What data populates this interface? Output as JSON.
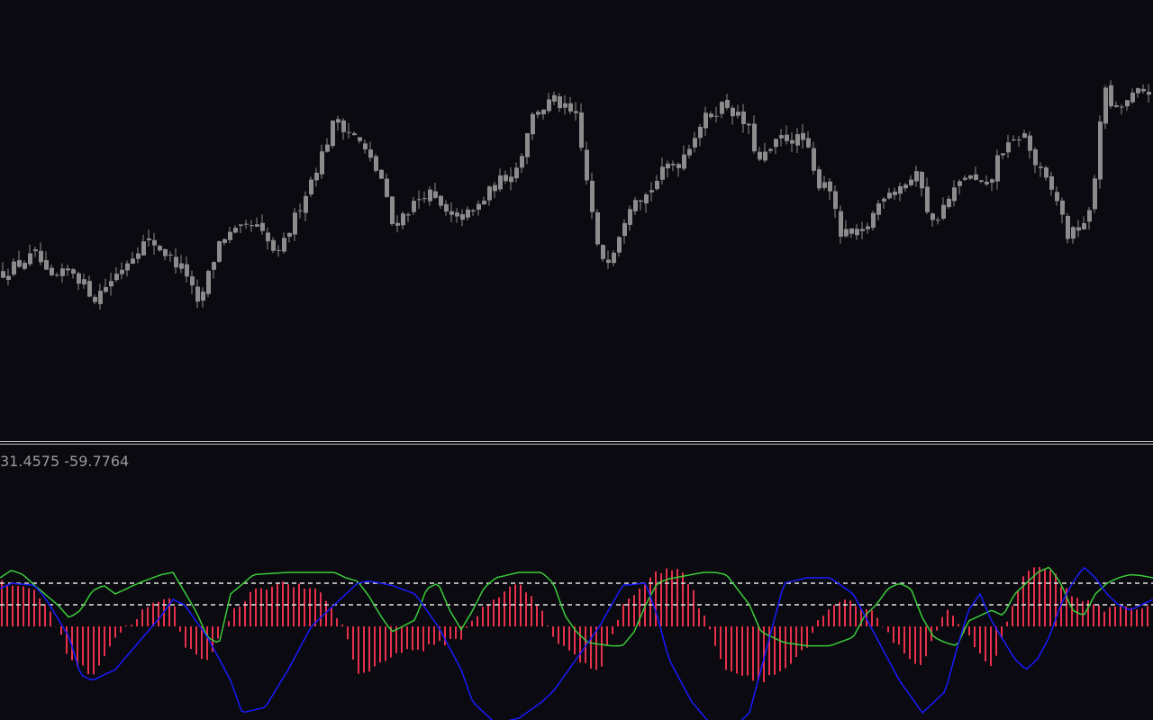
{
  "indicator": {
    "label": "31.4575 -59.7764"
  },
  "colors": {
    "background": "#0a0a10",
    "candle": "#8c8c8c",
    "separator": "#c0c0c0",
    "histogram": "#e8304a",
    "line_fast": "#3ccc3c",
    "line_slow": "#1a1aff",
    "level_lines": "#e6e6e6",
    "label_text": "#9a9a9a"
  },
  "chart_data": [
    {
      "type": "candlestick",
      "title": "",
      "xlabel": "",
      "ylabel": "",
      "ylim": [
        0,
        100
      ],
      "grid": false,
      "close_path": [
        [
          0,
          22
        ],
        [
          3,
          28
        ],
        [
          4,
          19
        ],
        [
          6,
          23
        ],
        [
          8,
          14
        ],
        [
          10,
          22
        ],
        [
          12,
          31
        ],
        [
          13,
          32
        ],
        [
          16,
          22
        ],
        [
          17,
          11
        ],
        [
          19,
          33
        ],
        [
          22,
          37
        ],
        [
          24,
          27
        ],
        [
          26,
          44
        ],
        [
          28,
          61
        ],
        [
          29,
          71
        ],
        [
          31,
          64
        ],
        [
          33,
          52
        ],
        [
          34,
          37
        ],
        [
          37,
          48
        ],
        [
          39,
          39
        ],
        [
          41,
          41
        ],
        [
          43,
          50
        ],
        [
          45,
          56
        ],
        [
          46,
          71
        ],
        [
          48,
          77
        ],
        [
          50,
          71
        ],
        [
          51,
          50
        ],
        [
          52,
          27
        ],
        [
          53,
          27
        ],
        [
          55,
          47
        ],
        [
          56,
          46
        ],
        [
          58,
          56
        ],
        [
          59,
          57
        ],
        [
          61,
          70
        ],
        [
          63,
          76
        ],
        [
          65,
          68
        ],
        [
          66,
          57
        ],
        [
          68,
          65
        ],
        [
          70,
          64
        ],
        [
          71,
          50
        ],
        [
          72,
          52
        ],
        [
          73,
          34
        ],
        [
          75,
          34
        ],
        [
          77,
          48
        ],
        [
          78,
          49
        ],
        [
          80,
          53
        ],
        [
          81,
          37
        ],
        [
          84,
          53
        ],
        [
          86,
          48
        ],
        [
          87,
          61
        ],
        [
          88,
          62
        ],
        [
          89,
          67
        ],
        [
          90,
          57
        ],
        [
          92,
          45
        ],
        [
          93,
          33
        ],
        [
          95,
          41
        ],
        [
          96,
          81
        ],
        [
          97,
          73
        ],
        [
          99,
          79
        ],
        [
          100,
          80
        ]
      ]
    },
    {
      "type": "line",
      "title": "",
      "xlabel": "",
      "ylabel": "",
      "ylim": [
        -100,
        100
      ],
      "levels": [
        40,
        20
      ],
      "grid": false,
      "series": [
        {
          "role": "histogram",
          "x": [
            0,
            3,
            5,
            6,
            8,
            10,
            13,
            15,
            16,
            18,
            20,
            22,
            25,
            28,
            30,
            31,
            33,
            34,
            37,
            40,
            42,
            45,
            47,
            48,
            50,
            52,
            54,
            57,
            59,
            60,
            63,
            66,
            68,
            70,
            71,
            73,
            76,
            78,
            80,
            82,
            84,
            86,
            88,
            89,
            91,
            93,
            95,
            96,
            98,
            100
          ],
          "values": [
            40,
            35,
            0,
            -30,
            -45,
            -10,
            20,
            25,
            -20,
            -30,
            10,
            35,
            40,
            30,
            -5,
            -45,
            -35,
            -25,
            -20,
            -10,
            20,
            40,
            15,
            -10,
            -30,
            -40,
            20,
            50,
            55,
            35,
            -40,
            -50,
            -40,
            -20,
            5,
            25,
            10,
            -20,
            -40,
            20,
            -10,
            -40,
            25,
            50,
            55,
            25,
            20,
            15,
            20,
            15
          ]
        },
        {
          "role": "fast",
          "x": [
            0,
            1,
            2,
            3,
            5,
            6,
            7,
            8,
            9,
            10,
            12,
            14,
            15,
            17,
            18,
            19,
            20,
            22,
            25,
            27,
            29,
            30,
            31,
            32,
            33,
            34,
            36,
            37,
            38,
            39,
            40,
            41,
            42,
            43,
            45,
            47,
            48,
            49,
            50,
            51,
            53,
            54,
            55,
            56,
            57,
            58,
            60,
            61,
            62,
            63,
            65,
            66,
            67,
            68,
            70,
            72,
            74,
            75,
            76,
            77,
            78,
            79,
            80,
            81,
            82,
            83,
            84,
            85,
            86,
            87,
            88,
            89,
            90,
            91,
            92,
            93,
            94,
            95,
            96,
            97,
            98,
            99,
            100
          ],
          "values": [
            45,
            52,
            48,
            38,
            20,
            8,
            15,
            33,
            38,
            30,
            40,
            48,
            50,
            14,
            -10,
            -16,
            30,
            48,
            50,
            50,
            50,
            45,
            42,
            28,
            10,
            -5,
            6,
            35,
            40,
            15,
            -3,
            15,
            36,
            45,
            50,
            50,
            40,
            10,
            -5,
            -15,
            -18,
            -18,
            -5,
            20,
            40,
            44,
            48,
            50,
            50,
            48,
            20,
            -5,
            -10,
            -15,
            -18,
            -18,
            -10,
            10,
            20,
            35,
            40,
            35,
            8,
            -10,
            -15,
            -18,
            5,
            10,
            15,
            10,
            30,
            40,
            50,
            55,
            40,
            15,
            10,
            30,
            40,
            45,
            48,
            47,
            45
          ]
        },
        {
          "role": "slow",
          "x": [
            0,
            1,
            3,
            4,
            6,
            7,
            8,
            10,
            12,
            14,
            15,
            16,
            18,
            20,
            21,
            23,
            25,
            27,
            29,
            31,
            32,
            34,
            36,
            38,
            40,
            41,
            43,
            45,
            47,
            48,
            50,
            52,
            54,
            56,
            57,
            58,
            60,
            62,
            63,
            65,
            66,
            67,
            68,
            70,
            72,
            74,
            76,
            78,
            80,
            82,
            83,
            84,
            85,
            86,
            88,
            89,
            90,
            91,
            92,
            93,
            94,
            95,
            96,
            97,
            98,
            100
          ],
          "values": [
            35,
            40,
            38,
            25,
            -10,
            -45,
            -50,
            -40,
            -15,
            10,
            25,
            20,
            -10,
            -50,
            -80,
            -75,
            -40,
            0,
            20,
            40,
            42,
            38,
            30,
            0,
            -40,
            -70,
            -90,
            -85,
            -70,
            -60,
            -30,
            0,
            38,
            40,
            10,
            -30,
            -70,
            -95,
            -100,
            -80,
            -40,
            0,
            40,
            45,
            45,
            30,
            -10,
            -50,
            -80,
            -60,
            -20,
            15,
            30,
            5,
            -30,
            -40,
            -30,
            -10,
            20,
            40,
            55,
            45,
            30,
            20,
            15,
            25
          ]
        }
      ]
    }
  ]
}
